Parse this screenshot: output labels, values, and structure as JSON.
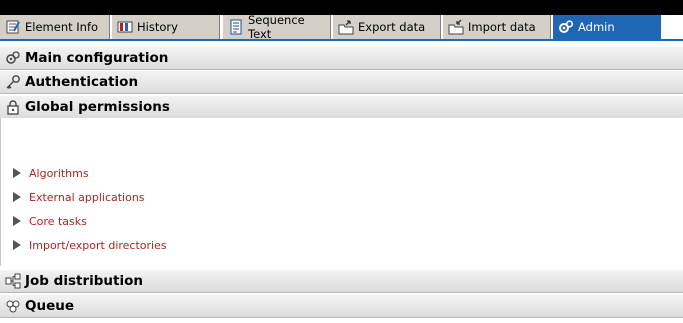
{
  "tabs": [
    {
      "label": "Element Info",
      "icon": "element-info-icon"
    },
    {
      "label": "History",
      "icon": "history-icon"
    },
    {
      "label": "Sequence Text",
      "icon": "sequence-text-icon"
    },
    {
      "label": "Export data",
      "icon": "export-data-icon"
    },
    {
      "label": "Import data",
      "icon": "import-data-icon"
    },
    {
      "label": "Admin",
      "icon": "admin-icon",
      "active": true
    }
  ],
  "sections": {
    "main_configuration": {
      "label": "Main configuration",
      "icon": "gears-icon"
    },
    "authentication": {
      "label": "Authentication",
      "icon": "key-icon"
    },
    "global_permissions": {
      "label": "Global permissions",
      "icon": "lock-icon"
    },
    "job_distribution": {
      "label": "Job distribution",
      "icon": "job-distribution-icon"
    },
    "queue": {
      "label": "Queue",
      "icon": "queue-icon"
    }
  },
  "permissions_links": [
    "Algorithms",
    "External applications",
    "Core tasks",
    "Import/export directories"
  ],
  "colors": {
    "accent": "#1f66b4",
    "link": "#b22222",
    "tab_bg": "#d4d0c8"
  }
}
